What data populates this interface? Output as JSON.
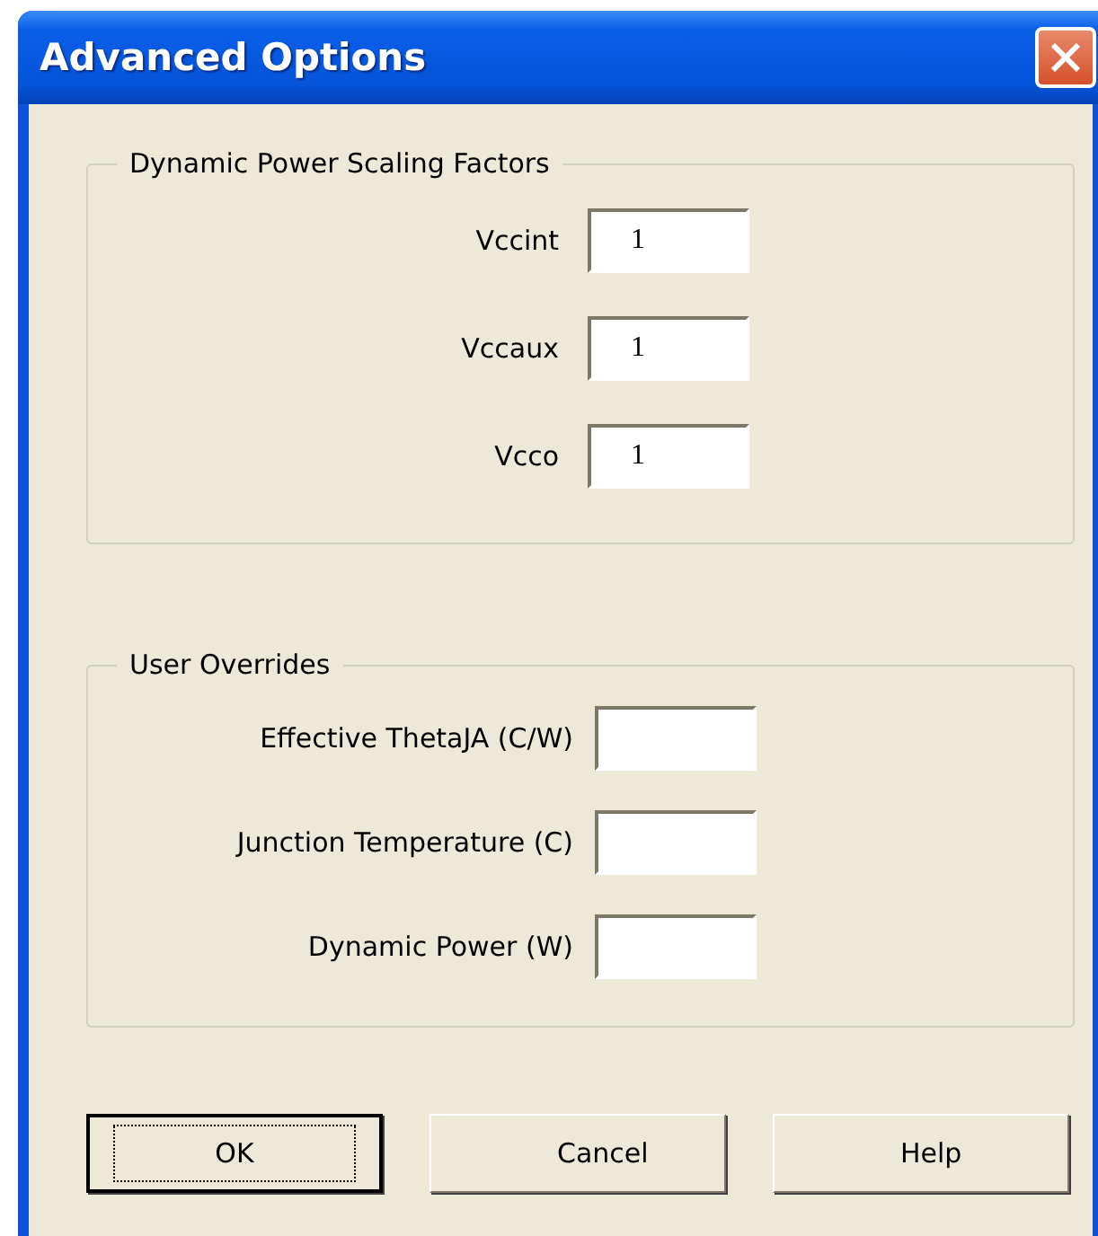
{
  "window": {
    "title": "Advanced Options"
  },
  "groups": [
    {
      "title": "Dynamic Power Scaling Factors",
      "kind": "short",
      "fields": [
        {
          "label": "Vccint",
          "value": "1"
        },
        {
          "label": "Vccaux",
          "value": "1"
        },
        {
          "label": "Vcco",
          "value": "1"
        }
      ]
    },
    {
      "title": "User Overrides",
      "kind": "wide",
      "fields": [
        {
          "label": "Effective ThetaJA (C/W)"
        },
        {
          "label": "Junction Temperature (C)"
        },
        {
          "label": "Dynamic Power (W)"
        }
      ]
    }
  ],
  "buttons": [
    {
      "label": "OK",
      "selected": true
    },
    {
      "label": "Cancel",
      "selected": false
    },
    {
      "label": "Help",
      "selected": false
    }
  ]
}
